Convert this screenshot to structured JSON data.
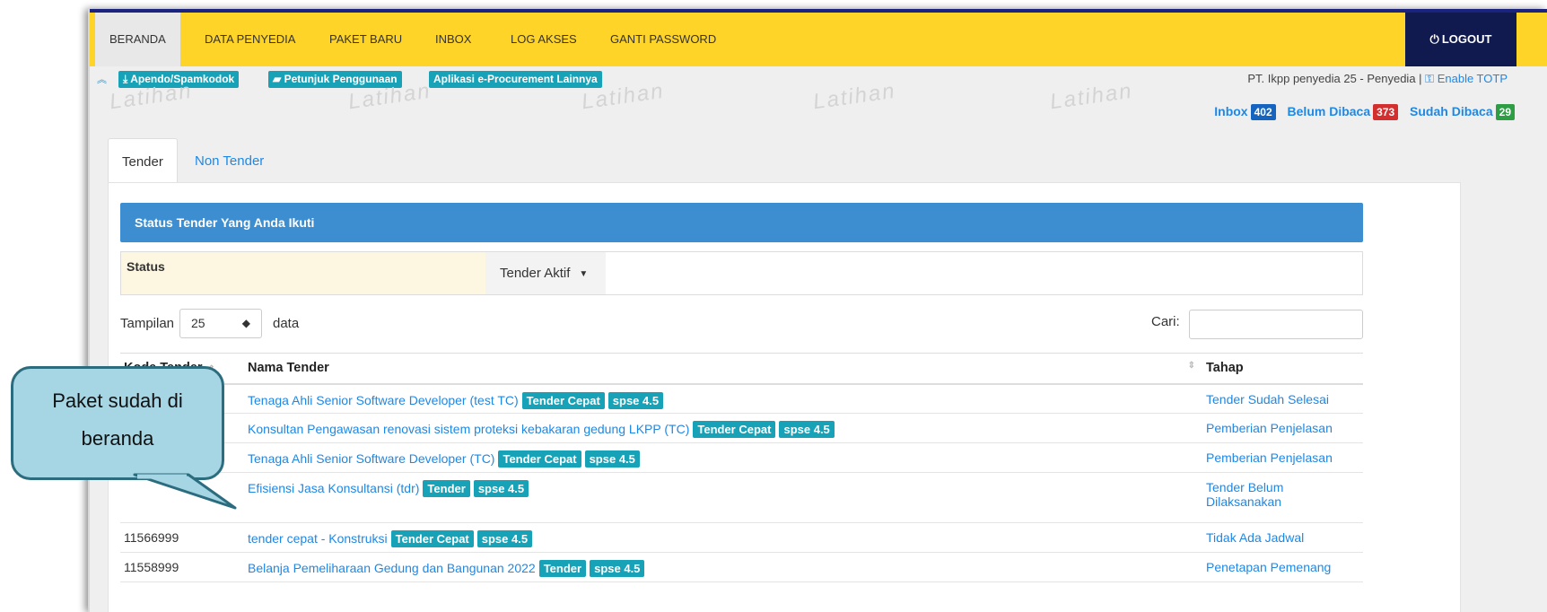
{
  "navbar": {
    "items": [
      "BERANDA",
      "DATA PENYEDIA",
      "PAKET BARU",
      "INBOX",
      "LOG AKSES",
      "GANTI PASSWORD"
    ],
    "logout": "LOGOUT"
  },
  "subbar": {
    "links": [
      "Apendo/Spamkodok",
      "Petunjuk Penggunaan",
      "Aplikasi e-Procurement Lainnya"
    ],
    "user": "PT. Ikpp penyedia 25 - Penyedia |",
    "totp": "Enable TOTP"
  },
  "watermark": "Latihan",
  "inbox": {
    "inbox_label": "Inbox",
    "inbox_count": "402",
    "unread_label": "Belum Dibaca",
    "unread_count": "373",
    "read_label": "Sudah Dibaca",
    "read_count": "29"
  },
  "tabs": [
    "Tender",
    "Non Tender"
  ],
  "panel_title": "Status Tender Yang Anda Ikuti",
  "status": {
    "label": "Status",
    "selected": "Tender Aktif"
  },
  "length": {
    "before": "Tampilan",
    "value": "25",
    "after": "data"
  },
  "search": {
    "label": "Cari:",
    "value": ""
  },
  "table": {
    "headers": [
      "Kode Tender",
      "Nama Tender",
      "Tahap"
    ],
    "rows": [
      {
        "kode": "",
        "nama": "Tenaga Ahli Senior Software Developer (test TC)",
        "tags": [
          "Tender Cepat",
          "spse 4.5"
        ],
        "tahap": "Tender Sudah Selesai"
      },
      {
        "kode": "",
        "nama": "Konsultan Pengawasan renovasi sistem proteksi kebakaran gedung LKPP (TC)",
        "tags": [
          "Tender Cepat",
          "spse 4.5"
        ],
        "tahap": "Pemberian Penjelasan"
      },
      {
        "kode": "",
        "nama": "Tenaga Ahli Senior Software Developer (TC)",
        "tags": [
          "Tender Cepat",
          "spse 4.5"
        ],
        "tahap": "Pemberian Penjelasan"
      },
      {
        "kode": "",
        "nama": "Efisiensi Jasa Konsultansi (tdr)",
        "tags": [
          "Tender",
          "spse 4.5"
        ],
        "tahap": "Tender Belum Dilaksanakan"
      },
      {
        "kode": "11566999",
        "nama": "tender cepat - Konstruksi",
        "tags": [
          "Tender Cepat",
          "spse 4.5"
        ],
        "tahap": "Tidak Ada Jadwal"
      },
      {
        "kode": "11558999",
        "nama": "Belanja Pemeliharaan Gedung dan Bangunan 2022",
        "tags": [
          "Tender",
          "spse 4.5"
        ],
        "tahap": "Penetapan Pemenang"
      }
    ]
  },
  "callout": {
    "line1": "Paket sudah di",
    "line2": "beranda"
  },
  "colors": {
    "navbar": "#ffd429",
    "logout": "#101a4e",
    "panel_head": "#3d8ed0",
    "teal": "#17a2b8",
    "link": "#1e88e5",
    "callout_fill": "#a6d5e4",
    "callout_border": "#2c6c7f"
  }
}
